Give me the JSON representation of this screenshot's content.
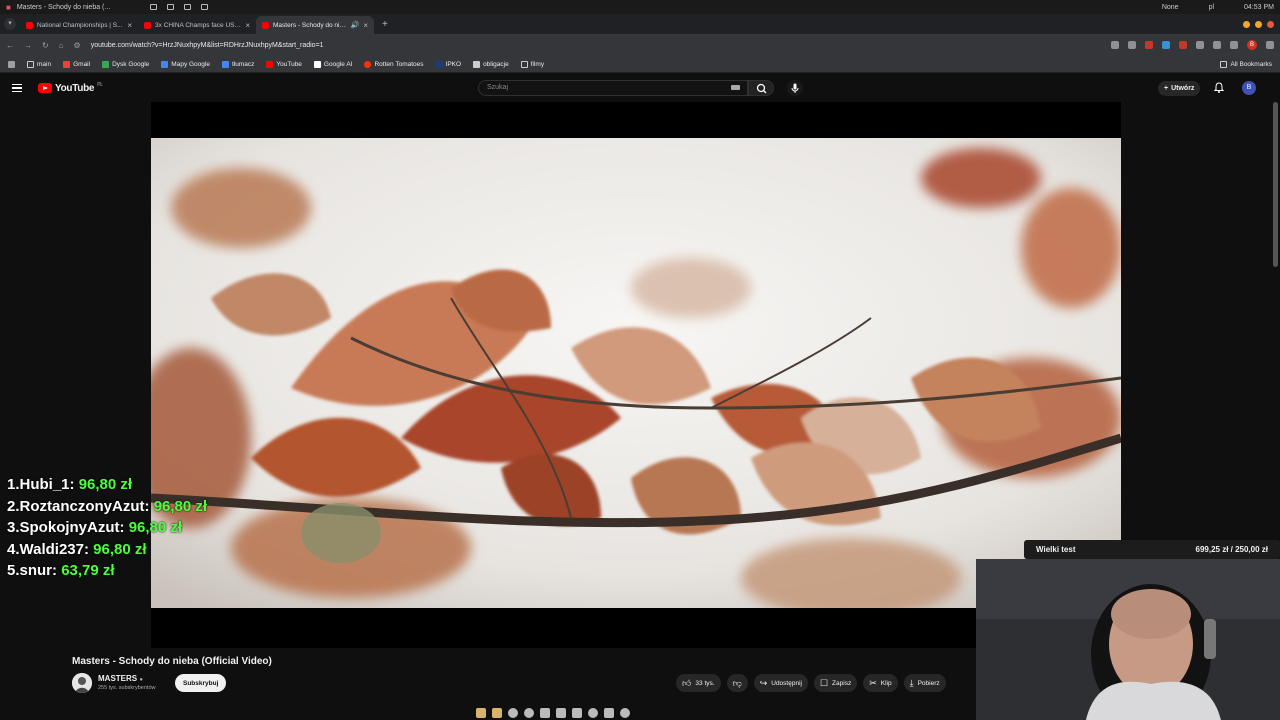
{
  "os_bar": {
    "window_title": "Masters - Schody do nieba (...",
    "right_items": [
      "None",
      "pl",
      "04:53 PM"
    ]
  },
  "tabs": [
    {
      "title": "National Championships | S...",
      "active": false
    },
    {
      "title": "3x CHINA Champs face USA...",
      "active": false
    },
    {
      "title": "Masters - Schody do nieb...",
      "active": true
    }
  ],
  "address_bar": {
    "url": "youtube.com/watch?v=HrzJNuxhpyM&list=RDHrzJNuxhpyM&start_radio=1",
    "profile_initial": "B"
  },
  "bookmarks": {
    "items": [
      "main",
      "Gmail",
      "Dysk Google",
      "Mapy Google",
      "tłumacz",
      "YouTube",
      "Google AI",
      "Rotten Tomatoes",
      "IPKO",
      "obligacje",
      "filmy"
    ],
    "all_label": "All Bookmarks"
  },
  "youtube": {
    "logo_text": "YouTube",
    "logo_region": "PL",
    "search_placeholder": "Szukaj",
    "create_label": "Utwórz",
    "avatar_initial": "B"
  },
  "leaderboard": [
    {
      "rank": "1.",
      "name": "Hubi_1:",
      "amount": "96,80 zł"
    },
    {
      "rank": "2.",
      "name": "RoztanczonyAzut:",
      "amount": "96,80 zł"
    },
    {
      "rank": "3.",
      "name": "SpokojnyAzut:",
      "amount": "96,80 zł"
    },
    {
      "rank": "4.",
      "name": "Waldi237:",
      "amount": "96,80 zł"
    },
    {
      "rank": "5.",
      "name": "snur:",
      "amount": "63,79 zł"
    }
  ],
  "goal": {
    "label": "Wielki test",
    "value": "699,25 zł / 250,00 zł"
  },
  "video": {
    "title": "Masters - Schody do nieba (Official Video)",
    "channel": "MASTERS",
    "subscribers": "255 tys. subskrybentów",
    "subscribe_label": "Subskrybuj",
    "likes": "33 tys.",
    "share_label": "Udostępnij",
    "save_label": "Zapisz",
    "clip_label": "Klip",
    "download_label": "Pobierz"
  },
  "colors": {
    "accent_red": "#ff0000",
    "donation_green": "#4cff3c"
  }
}
